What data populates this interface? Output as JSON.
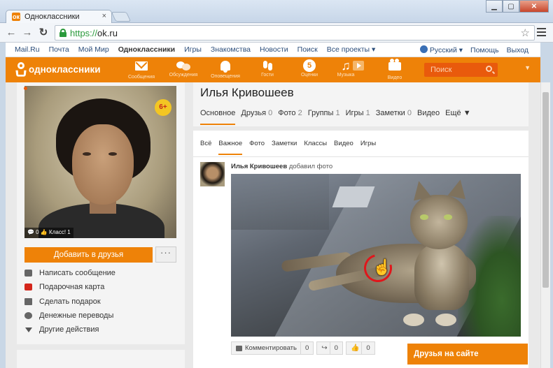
{
  "browser": {
    "tab_title": "Одноклассники",
    "tab_close": "×",
    "url_scheme": "https://",
    "url_host": "ok.ru",
    "back_icon": "arrow-left-icon",
    "forward_icon": "arrow-right-icon",
    "reload_icon": "reload-icon",
    "star_icon": "star-icon",
    "menu_icon": "hamburger-icon"
  },
  "portal": {
    "links": [
      "Mail.Ru",
      "Почта",
      "Мой Мир",
      "Одноклассники",
      "Игры",
      "Знакомства",
      "Новости",
      "Поиск",
      "Все проекты ▾"
    ],
    "active": "Одноклассники",
    "language": "Русский ▾",
    "help": "Помощь",
    "logout": "Выход"
  },
  "header": {
    "logo_text": "одноклассники",
    "items": [
      {
        "label": "Сообщения",
        "icon": "envelope-icon"
      },
      {
        "label": "Обсуждения",
        "icon": "speech-bubbles-icon"
      },
      {
        "label": "Оповещения",
        "icon": "bell-icon"
      },
      {
        "label": "Гости",
        "icon": "footprints-icon"
      },
      {
        "label": "Оценки",
        "icon": "rating-5-icon",
        "badge": "5"
      },
      {
        "label": "Музыка",
        "icon": "music-note-icon"
      },
      {
        "label": "Видео",
        "icon": "video-camera-icon"
      }
    ],
    "search_placeholder": "Поиск",
    "accent": "#ee8208"
  },
  "profile": {
    "name": "Илья Кривошеев",
    "age_badge": "6+",
    "photo_stats": "💬 0 👍 Класс! 1",
    "add_friend": "Добавить в друзья",
    "more": "···",
    "actions": [
      {
        "label": "Написать сообщение",
        "icon": "message-icon"
      },
      {
        "label": "Подарочная карта",
        "icon": "gift-card-icon"
      },
      {
        "label": "Сделать подарок",
        "icon": "present-icon"
      },
      {
        "label": "Денежные переводы",
        "icon": "money-transfer-icon"
      },
      {
        "label": "Другие действия",
        "icon": "triangle-down-icon"
      }
    ],
    "tabs": [
      {
        "label": "Основное",
        "count": ""
      },
      {
        "label": "Друзья",
        "count": "0"
      },
      {
        "label": "Фото",
        "count": "2"
      },
      {
        "label": "Группы",
        "count": "1"
      },
      {
        "label": "Игры",
        "count": "1"
      },
      {
        "label": "Заметки",
        "count": "0"
      },
      {
        "label": "Видео",
        "count": ""
      },
      {
        "label": "Ещё ▼",
        "count": ""
      }
    ]
  },
  "feed": {
    "tabs": [
      "Всё",
      "Важное",
      "Фото",
      "Заметки",
      "Классы",
      "Видео",
      "Игры"
    ],
    "active_tab": "Важное",
    "post": {
      "author": "Илья Кривошеев",
      "action": "добавил фото",
      "comment_label": "Комментировать",
      "comment_count": "0",
      "share_count": "0",
      "like_count": "0"
    }
  },
  "friends_online": "Друзья на сайте"
}
